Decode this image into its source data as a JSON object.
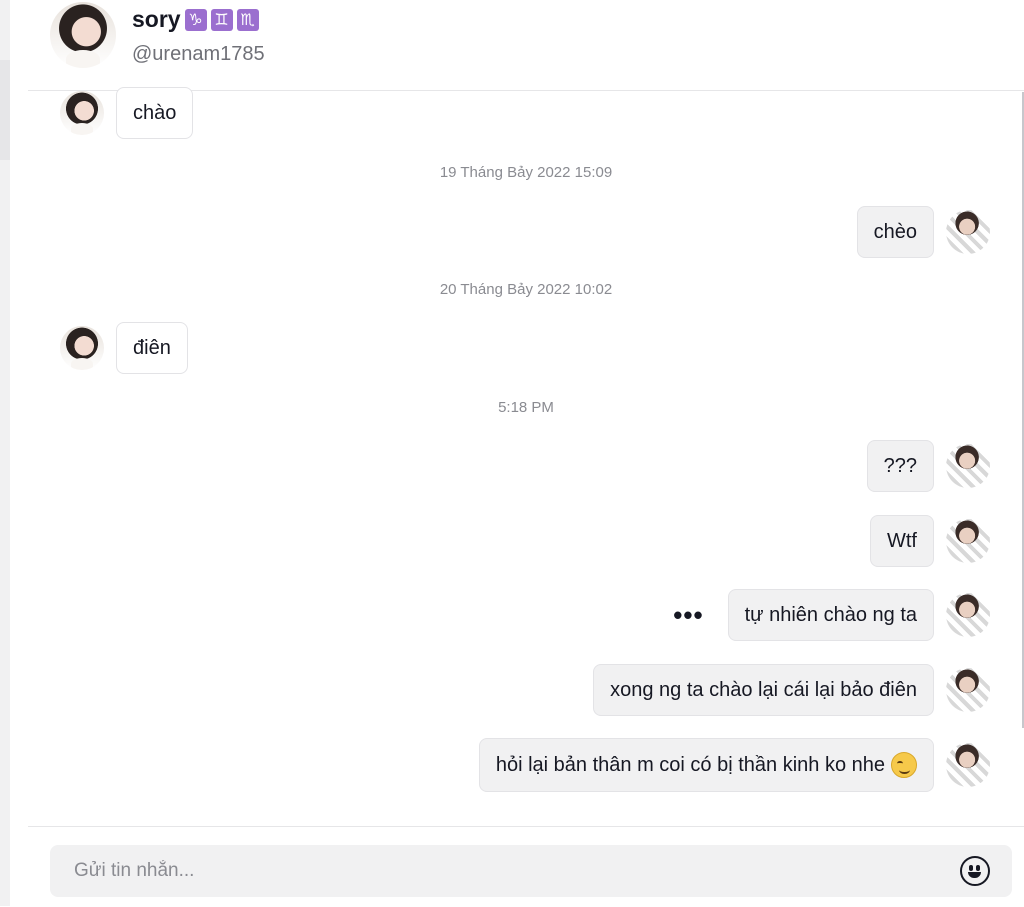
{
  "header": {
    "name": "sory",
    "zodiac": [
      "♑",
      "♊",
      "♏"
    ],
    "handle": "@urenam1785"
  },
  "messages": [
    {
      "side": "in",
      "text": "chào"
    },
    {
      "timestamp": "19 Tháng Bảy 2022 15:09"
    },
    {
      "side": "out",
      "text": "chèo"
    },
    {
      "timestamp": "20 Tháng Bảy 2022 10:02"
    },
    {
      "side": "in",
      "text": "điên"
    },
    {
      "timestamp": "5:18 PM"
    },
    {
      "side": "out",
      "text": "???"
    },
    {
      "side": "out",
      "text": "Wtf"
    },
    {
      "side": "out",
      "text": "tự nhiên chào ng ta",
      "more_icon": "more-options-icon"
    },
    {
      "side": "out",
      "text": "xong ng ta chào lại cái lại bảo điên"
    },
    {
      "side": "out",
      "text": "hỏi lại bản thân m coi có bị thần kinh ko nhe",
      "emoji": "smirk-emoji"
    }
  ],
  "composer": {
    "placeholder": "Gửi tin nhắn...",
    "emoji_icon": "emoji-icon"
  }
}
